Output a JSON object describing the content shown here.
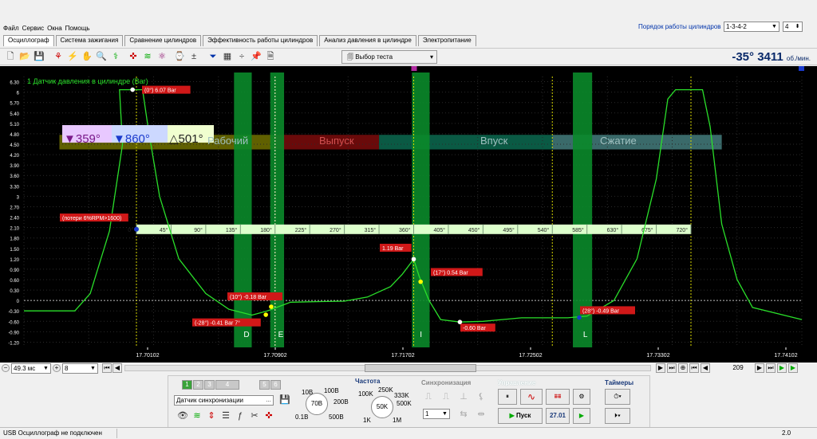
{
  "menu": [
    "Файл",
    "Сервис",
    "Окна",
    "Помощь"
  ],
  "cylinder_order": {
    "label": "Порядок работы цилиндров",
    "value": "1-3-4-2",
    "count": "4"
  },
  "tabs": [
    "Осциллограф",
    "Система зажигания",
    "Сравнение цилиндров",
    "Эффективность работы цилиндров",
    "Анализ давления в цилиндре",
    "Электропитание"
  ],
  "toolbar": {
    "test_select": "Выбор теста",
    "angle": "-35°",
    "rpm": "3411",
    "rpm_unit": "об./мин."
  },
  "plot": {
    "channel_title": "1 Датчик давления в цилиндре (Bar)",
    "y_ticks": [
      "6.30",
      "6",
      "5.70",
      "5.40",
      "5.10",
      "4.80",
      "4.50",
      "4.20",
      "3.90",
      "3.60",
      "3.30",
      "3",
      "2.70",
      "2.40",
      "2.10",
      "1.80",
      "1.50",
      "1.20",
      "0.90",
      "0.60",
      "0.30",
      "0",
      "-0.30",
      "-0.60",
      "-0.90",
      "-1.20"
    ],
    "x_ticks": [
      "17.70102",
      "17.70902",
      "17.71702",
      "17.72502",
      "17.73302",
      "17.74102"
    ],
    "degree_ticks": [
      "0°",
      "45°",
      "90°",
      "135°",
      "180°",
      "225°",
      "270°",
      "315°",
      "360°",
      "405°",
      "450°",
      "495°",
      "540°",
      "585°",
      "630°",
      "675°",
      "720°"
    ],
    "strokes": [
      "Рабочий",
      "Выпуск",
      "Впуск",
      "Сжатие"
    ],
    "markers": {
      "red": "359°",
      "blue": "860°",
      "delta": "501°"
    },
    "loss_label": "(потери 6%RPM>1600)",
    "labels": [
      "(0°) 6.07 Bar",
      "(10°) -0.18 Bar",
      "(-28°) -0.41 Bar 7°",
      "1.19 Bar",
      "(17°) 0.54 Bar",
      "-0.60 Bar",
      "(28°) -0.49 Bar"
    ],
    "band_letters": [
      "D",
      "E",
      "I",
      "L"
    ]
  },
  "timebase": {
    "value": "49.3 мс",
    "zoom": "8",
    "page": "209"
  },
  "channels": {
    "tabs": [
      "1",
      "2",
      "3",
      "4",
      "5",
      "6"
    ],
    "sensor": "Датчик синхронизации"
  },
  "voltage": {
    "value": "70В",
    "ticks": [
      "10В",
      "100В",
      "200В",
      "500В",
      "0.1В"
    ]
  },
  "frequency": {
    "title": "Частота",
    "value": "50K",
    "ticks": [
      "100K",
      "250K",
      "333K",
      "500K",
      "1K",
      "1M"
    ]
  },
  "sync": {
    "title": "Синхронизация",
    "value": "1"
  },
  "control": {
    "title": "Управление",
    "start": "Пуск",
    "value": "27.01"
  },
  "timers": {
    "title": "Таймеры"
  },
  "status": {
    "left": "USB Осциллограф не подключен",
    "right": "2.0"
  },
  "chart_data": {
    "type": "line",
    "title": "1 Датчик давления в цилиндре (Bar)",
    "ylim": [
      -1.35,
      6.45
    ],
    "series": [
      {
        "name": "1 Датчик давления в цилиндре (Bar)",
        "x": [
          0,
          45,
          90,
          135,
          180,
          225,
          270,
          315,
          345,
          360,
          375,
          405,
          450,
          495,
          540,
          585,
          630,
          675,
          720
        ],
        "values": [
          6.07,
          4.2,
          0.2,
          -0.3,
          -0.18,
          -0.05,
          -0.02,
          0.15,
          0.5,
          1.19,
          0.54,
          -0.6,
          -0.55,
          -0.5,
          -0.5,
          -0.49,
          1.2,
          4.5,
          6.07
        ]
      }
    ],
    "grid": true
  }
}
